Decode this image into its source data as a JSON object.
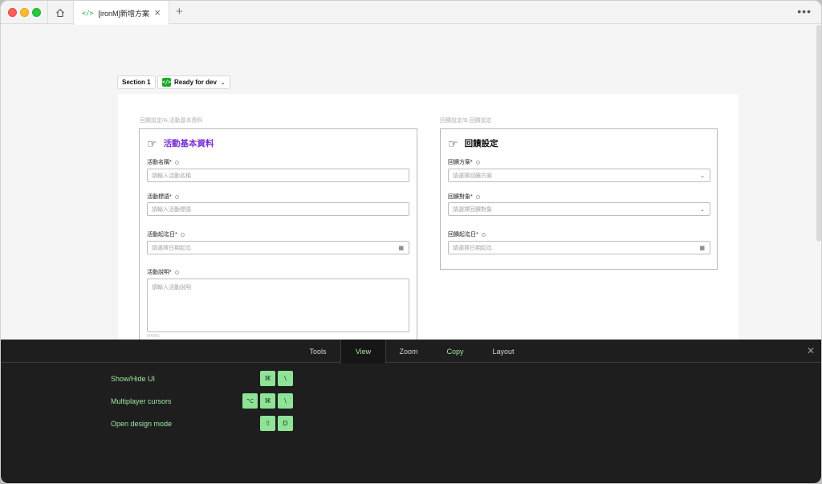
{
  "tab": {
    "icon": "</>",
    "title": "[ironM]新增方案"
  },
  "chips": {
    "section": "Section 1",
    "status": "Ready for dev"
  },
  "left": {
    "crumb": "回饋設定/A.活動基本資料",
    "title": "活動基本資料",
    "title_color": "#7b2fd6",
    "fields": [
      {
        "label": "活動名稱*",
        "placeholder": "請輸入活動名稱"
      },
      {
        "label": "活動標語*",
        "placeholder": "請輸入活動標語"
      },
      {
        "label": "活動起迄日*",
        "placeholder": "請選擇日期起迄"
      },
      {
        "label": "活動說明*",
        "placeholder": "請輸入活動說明"
      }
    ],
    "counter": "0/4000"
  },
  "right": {
    "crumb": "回饋設定/B.回饋設定",
    "title": "回饋設定",
    "fields": [
      {
        "label": "回饋方案*",
        "placeholder": "請選擇回饋方案"
      },
      {
        "label": "回饋對象*",
        "placeholder": "請選擇回饋對象"
      },
      {
        "label": "回饋起迄日*",
        "placeholder": "請選擇日期起迄"
      }
    ]
  },
  "bottom": {
    "tabs": [
      "Tools",
      "View",
      "Zoom",
      "Copy",
      "Layout"
    ],
    "active_tab": "View",
    "shortcuts": [
      {
        "label": "Show/Hide UI",
        "keys": [
          "⌘",
          "\\"
        ]
      },
      {
        "label": "Multiplayer cursors",
        "keys": [
          "⌥",
          "⌘",
          "\\"
        ]
      },
      {
        "label": "Open design mode",
        "keys": [
          "⇧",
          "D"
        ]
      }
    ]
  },
  "colors": {
    "accent_green": "#8ee396",
    "tab_active_text": "#9ee6a1"
  }
}
